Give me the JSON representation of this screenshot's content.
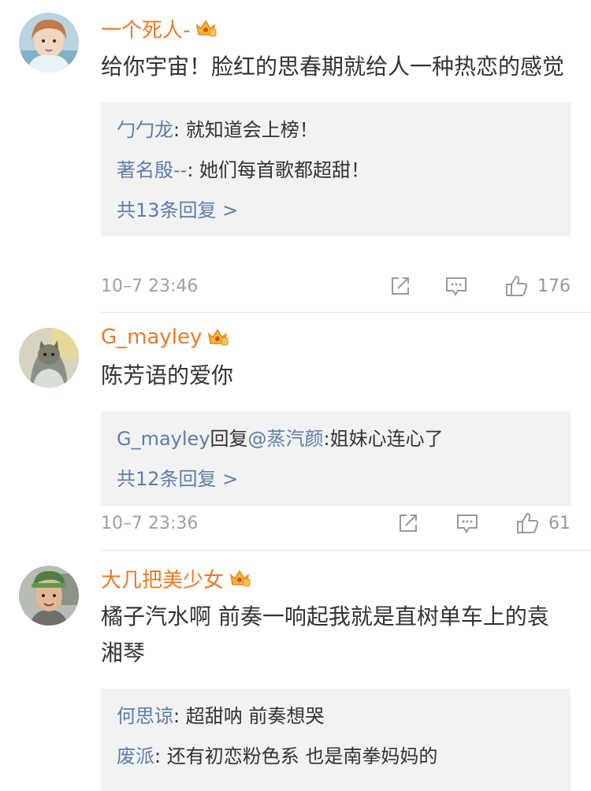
{
  "comments": [
    {
      "username": "一个死人-",
      "text": "给你宇宙！脸红的思春期就给人一种热恋的感觉",
      "replies": [
        {
          "user": "勹勹龙",
          "sep": ": ",
          "text": "就知道会上榜！"
        },
        {
          "user": "著名殷--",
          "sep": ": ",
          "text": "她们每首歌都超甜！"
        }
      ],
      "more": "共13条回复 >",
      "time": "10–7 23:46",
      "likes": "176"
    },
    {
      "username": "G_mayley",
      "text": "陈芳语的爱你",
      "replies": [
        {
          "user": "G_mayley",
          "mid": "回复",
          "mention": "@蒸汽颜",
          "sep": ":",
          "text": "姐妹心连心了"
        }
      ],
      "more": "共12条回复 >",
      "time": "10–7 23:36",
      "likes": "61"
    },
    {
      "username": "大几把美少女",
      "text": "橘子汽水啊 前奏一响起我就是直树单车上的袁湘琴",
      "replies": [
        {
          "user": "何思谅",
          "sep": ": ",
          "text": "超甜呐 前奏想哭"
        },
        {
          "user": "废派",
          "sep": ": ",
          "text": "还有初恋粉色系 也是南拳妈妈的"
        }
      ]
    }
  ],
  "colors": {
    "username": "#ea7a28",
    "reply_user": "#5b7fa8",
    "reply_bg": "#f2f2f2",
    "meta": "#a0a0a0"
  },
  "icons": [
    "vip-crown-icon",
    "repost-icon",
    "comment-icon",
    "like-icon"
  ]
}
